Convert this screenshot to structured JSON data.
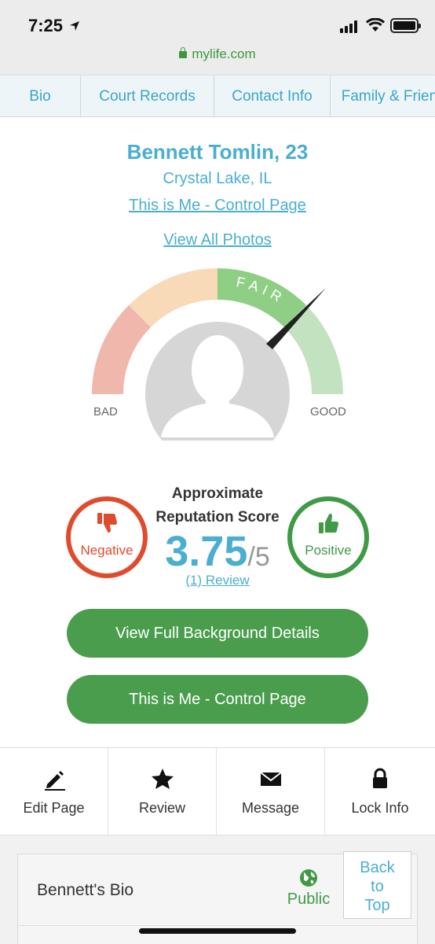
{
  "status_bar": {
    "time": "7:25",
    "url": "mylife.com"
  },
  "tabs": [
    {
      "label": "Bio"
    },
    {
      "label": "Court Records"
    },
    {
      "label": "Contact Info"
    },
    {
      "label": "Family & Friends"
    }
  ],
  "profile": {
    "name": "Bennett Tomlin, 23",
    "location": "Crystal Lake, IL",
    "control_link": "This is Me - Control Page",
    "photos_link": "View All Photos"
  },
  "gauge": {
    "active_label": "FAIR",
    "left_label": "BAD",
    "right_label": "GOOD",
    "colors": {
      "bad": "#f0b7ac",
      "mid": "#f8d9b8",
      "fair": "#8fcf85",
      "good": "#c3e2c0"
    }
  },
  "reputation": {
    "title_line1": "Approximate",
    "title_line2": "Reputation Score",
    "score": "3.75",
    "out_of": "/5",
    "review_link": "(1) Review",
    "negative_label": "Negative",
    "positive_label": "Positive"
  },
  "buttons": {
    "background": "View Full Background Details",
    "control": "This is Me - Control Page"
  },
  "actions": [
    {
      "label": "Edit Page",
      "icon": "pencil-icon"
    },
    {
      "label": "Review",
      "icon": "star-icon"
    },
    {
      "label": "Message",
      "icon": "envelope-icon"
    },
    {
      "label": "Lock Info",
      "icon": "lock-icon"
    }
  ],
  "bio": {
    "title": "Bennett's Bio",
    "visibility": "Public",
    "back_to_top": [
      "Back",
      "to",
      "Top"
    ]
  },
  "colors": {
    "accent": "#4aaed0",
    "green": "#4a9d4d",
    "negative": "#e04b2e",
    "positive": "#3f9a46"
  }
}
